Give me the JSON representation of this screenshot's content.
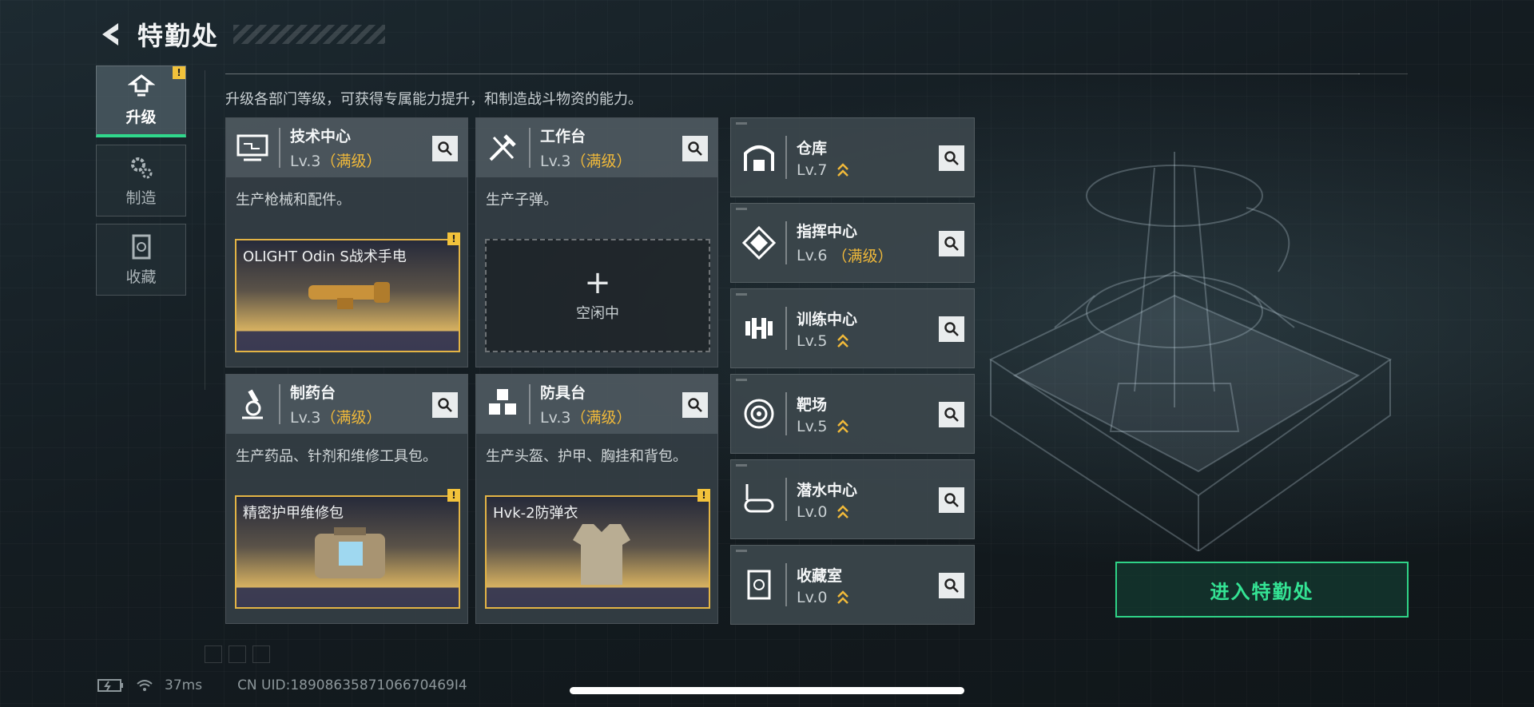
{
  "header": {
    "title": "特勤处"
  },
  "nav": [
    {
      "label": "升级",
      "icon": "upgrade-icon",
      "active": true,
      "badge": "!"
    },
    {
      "label": "制造",
      "icon": "gears-icon",
      "active": false
    },
    {
      "label": "收藏",
      "icon": "collection-icon",
      "active": false
    }
  ],
  "subtitle": "升级各部门等级，可获得专属能力提升，和制造战斗物资的能力。",
  "departments": [
    {
      "name": "技术中心",
      "level": "Lv.3",
      "max": "（满级）",
      "icon": "monitor-icon",
      "desc": "生产枪械和配件。",
      "product": "OLIGHT Odin S战术手电",
      "badge": "!"
    },
    {
      "name": "工作台",
      "level": "Lv.3",
      "max": "（满级）",
      "icon": "tools-icon",
      "desc": "生产子弹。",
      "empty_label": "空闲中"
    },
    {
      "name": "制药台",
      "level": "Lv.3",
      "max": "（满级）",
      "icon": "microscope-icon",
      "desc": "生产药品、针剂和维修工具包。",
      "product": "精密护甲维修包",
      "badge": "!"
    },
    {
      "name": "防具台",
      "level": "Lv.3",
      "max": "（满级）",
      "icon": "cubes-icon",
      "desc": "生产头盔、护甲、胸挂和背包。",
      "product": "Hvk-2防弹衣",
      "badge": "!"
    }
  ],
  "facilities": [
    {
      "name": "仓库",
      "level": "Lv.7",
      "max": "",
      "icon": "warehouse-icon",
      "upgradable": true
    },
    {
      "name": "指挥中心",
      "level": "Lv.6",
      "max": "（满级）",
      "icon": "command-icon",
      "upgradable": false
    },
    {
      "name": "训练中心",
      "level": "Lv.5",
      "max": "",
      "icon": "dumbbell-icon",
      "upgradable": true
    },
    {
      "name": "靶场",
      "level": "Lv.5",
      "max": "",
      "icon": "target-icon",
      "upgradable": true
    },
    {
      "name": "潜水中心",
      "level": "Lv.0",
      "max": "",
      "icon": "goggles-icon",
      "upgradable": true
    },
    {
      "name": "收藏室",
      "level": "Lv.0",
      "max": "",
      "icon": "vault-icon",
      "upgradable": true
    }
  ],
  "enter_button": "进入特勤处",
  "status": {
    "ping": "37ms",
    "uid": "CN UID:1890863587106670469I4"
  },
  "colors": {
    "accent": "#30d88c",
    "gold": "#f0b93a"
  }
}
